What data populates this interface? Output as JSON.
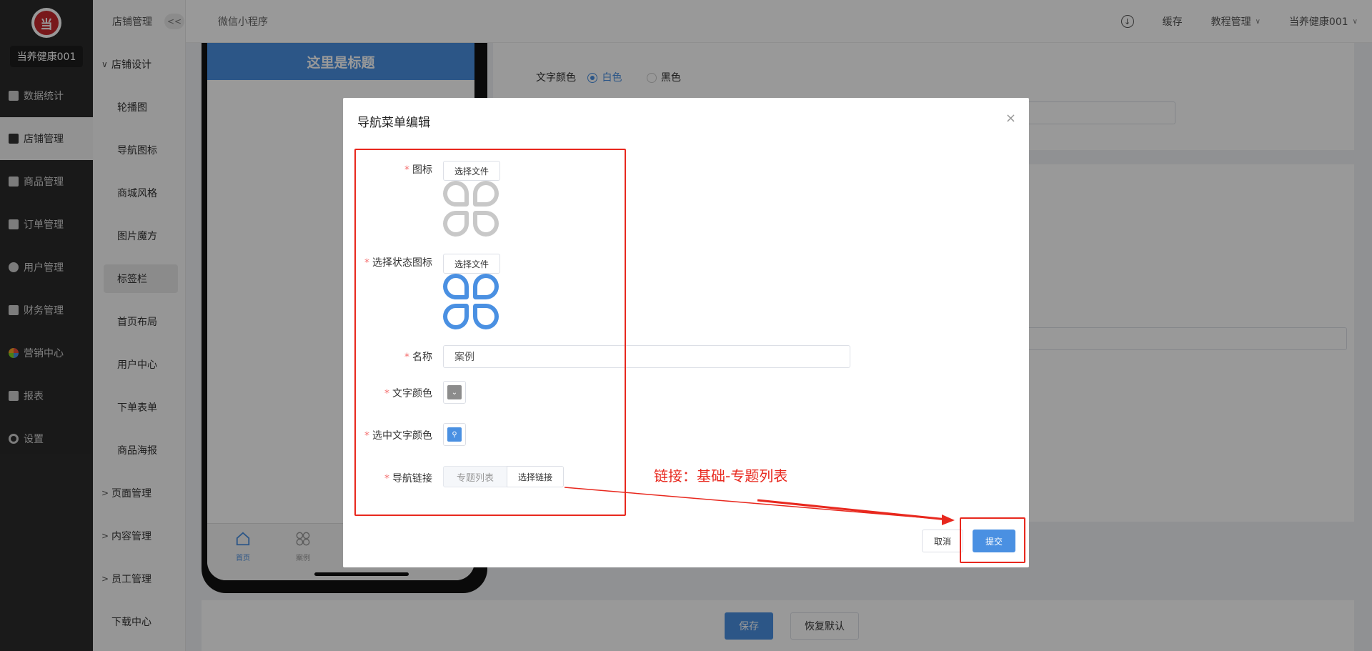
{
  "brand": {
    "logo_text": "当",
    "store_name": "当养健康001"
  },
  "sidebar": {
    "items": [
      {
        "label": "数据统计",
        "icon": "chart-icon"
      },
      {
        "label": "店铺管理",
        "icon": "store-icon",
        "active": true
      },
      {
        "label": "商品管理",
        "icon": "box-icon"
      },
      {
        "label": "订单管理",
        "icon": "clipboard-icon"
      },
      {
        "label": "用户管理",
        "icon": "user-icon"
      },
      {
        "label": "财务管理",
        "icon": "finance-icon"
      },
      {
        "label": "营销中心",
        "icon": "marketing-icon"
      },
      {
        "label": "报表",
        "icon": "report-icon"
      },
      {
        "label": "设置",
        "icon": "gear-icon"
      }
    ]
  },
  "subbar": {
    "title": "店铺管理",
    "collapse_label": "<<",
    "groups": [
      {
        "label": "店铺设计",
        "arrow": "∨"
      },
      {
        "label": "页面管理",
        "arrow": ">"
      },
      {
        "label": "内容管理",
        "arrow": ">"
      },
      {
        "label": "员工管理",
        "arrow": ">"
      },
      {
        "label": "下载中心",
        "arrow": ""
      }
    ],
    "items": [
      {
        "label": "轮播图"
      },
      {
        "label": "导航图标"
      },
      {
        "label": "商城风格"
      },
      {
        "label": "图片魔方"
      },
      {
        "label": "标签栏",
        "active": true
      },
      {
        "label": "首页布局"
      },
      {
        "label": "用户中心"
      },
      {
        "label": "下单表单"
      },
      {
        "label": "商品海报"
      }
    ]
  },
  "topbar": {
    "title": "微信小程序",
    "cache": "缓存",
    "tutorial": "教程管理",
    "user": "当养健康001"
  },
  "phone": {
    "title": "这里是标题",
    "tabs": [
      {
        "label": "首页",
        "color": "#4a90e2"
      },
      {
        "label": "案例",
        "color": "#999999"
      }
    ]
  },
  "background_form": {
    "text_color_label": "文字颜色",
    "white_label": "白色",
    "black_label": "黑色",
    "save_label": "保存",
    "reset_label": "恢复默认"
  },
  "modal": {
    "title": "导航菜单编辑",
    "close": "×",
    "fields": {
      "icon_label": "图标",
      "select_icon_label": "选择状态图标",
      "name_label": "名称",
      "text_color_label": "文字颜色",
      "selected_text_color_label": "选中文字颜色",
      "nav_link_label": "导航链接",
      "select_file": "选择文件",
      "name_value": "案例",
      "link_value": "专题列表",
      "select_link": "选择链接",
      "text_color": "#8c8c8c",
      "selected_text_color": "#4a90e2"
    },
    "cancel_label": "取消",
    "submit_label": "提交"
  },
  "annotation": {
    "text": "链接：基础-专题列表",
    "color": "#e8281e"
  },
  "colors": {
    "accent": "#4a90e2",
    "sidebar_bg": "#2b2b2b",
    "annotation": "#e8281e"
  }
}
